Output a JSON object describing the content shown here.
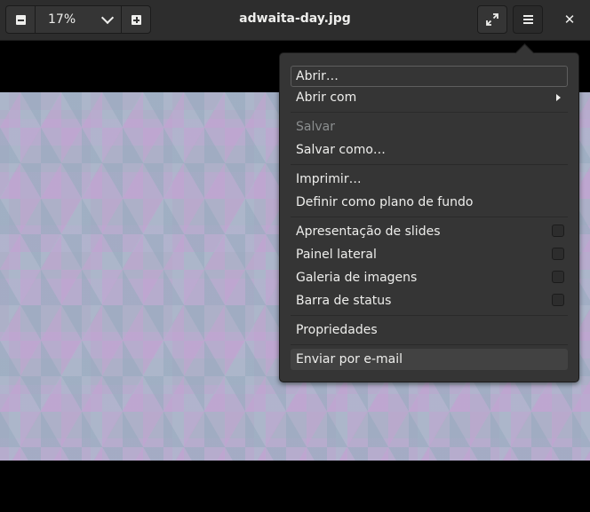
{
  "header": {
    "zoom_value": "17%",
    "title": "adwaita-day.jpg"
  },
  "menu": {
    "open": "Abrir…",
    "open_with": "Abrir com",
    "save": "Salvar",
    "save_as": "Salvar como…",
    "print": "Imprimir…",
    "set_background": "Definir como plano de fundo",
    "slideshow": "Apresentação de slides",
    "side_pane": "Painel lateral",
    "image_gallery": "Galeria de imagens",
    "status_bar": "Barra de status",
    "properties": "Propriedades",
    "send_email": "Enviar por e-mail"
  },
  "checkboxes": {
    "slideshow": false,
    "side_pane": false,
    "image_gallery": false,
    "status_bar": false
  },
  "icons": [
    "zoom-out-icon",
    "chevron-down-icon",
    "zoom-in-icon",
    "fullscreen-icon",
    "hamburger-menu-icon",
    "close-icon",
    "submenu-arrow-icon"
  ]
}
